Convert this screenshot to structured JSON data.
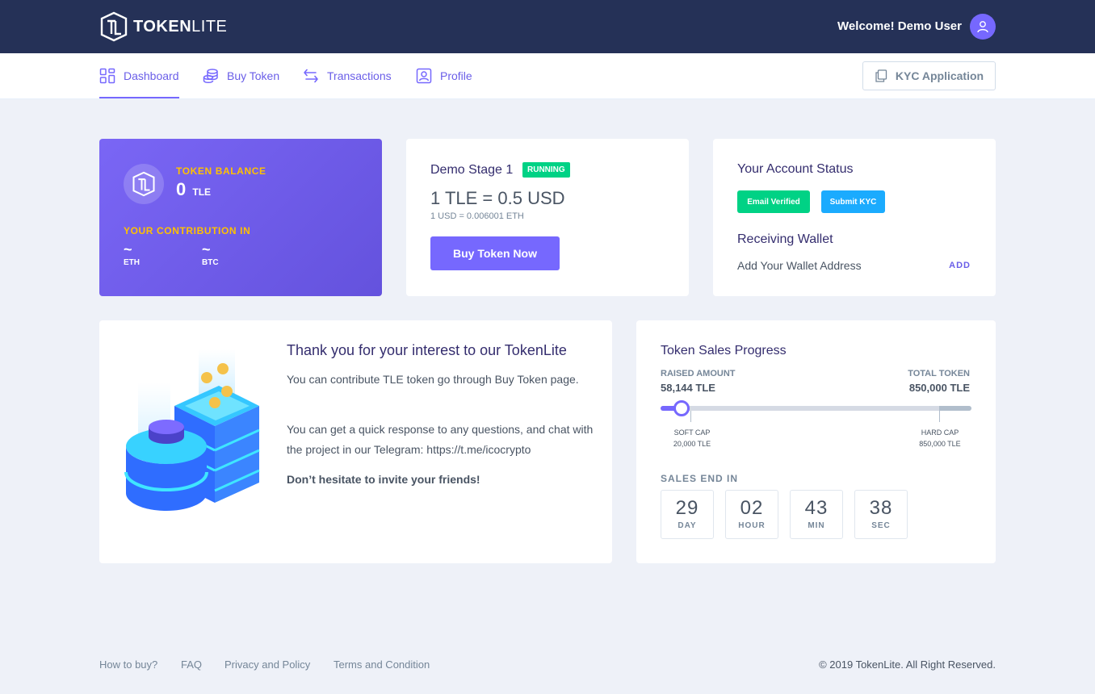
{
  "brand": {
    "logo_bold": "TOKEN",
    "logo_light": "LITE"
  },
  "header": {
    "welcome": "Welcome! Demo User"
  },
  "nav": {
    "items": [
      {
        "label": "Dashboard",
        "icon": "grid-icon"
      },
      {
        "label": "Buy Token",
        "icon": "coins-icon"
      },
      {
        "label": "Transactions",
        "icon": "exchange-arrows-icon"
      },
      {
        "label": "Profile",
        "icon": "user-card-icon"
      }
    ],
    "kyc_button": "KYC Application"
  },
  "balance": {
    "label": "TOKEN BALANCE",
    "value": "0",
    "unit": "TLE",
    "contribution_label": "YOUR CONTRIBUTION IN",
    "contributions": [
      {
        "value": "~",
        "currency": "ETH"
      },
      {
        "value": "~",
        "currency": "BTC"
      }
    ]
  },
  "stage": {
    "title": "Demo Stage 1",
    "status": "RUNNING",
    "price": "1 TLE = 0.5 USD",
    "sub_price": "1 USD = 0.006001 ETH",
    "button": "Buy Token Now"
  },
  "account": {
    "title": "Your Account Status",
    "email_badge": "Email Verified",
    "kyc_badge": "Submit KYC",
    "wallet_title": "Receiving Wallet",
    "wallet_text": "Add Your Wallet Address",
    "wallet_add": "ADD"
  },
  "info": {
    "title": "Thank you for your interest to our TokenLite",
    "p1": "You can contribute TLE token go through Buy Token page.",
    "p2": "You can get a quick response to any questions, and chat with the project in our Telegram: https://t.me/icocrypto",
    "p3": "Don’t hesitate to invite your friends!"
  },
  "progress": {
    "title": "Token Sales Progress",
    "raised_label": "RAISED AMOUNT",
    "raised_value": "58,144 TLE",
    "total_label": "TOTAL TOKEN",
    "total_value": "850,000 TLE",
    "raised_fraction": 0.0684,
    "soft_cap_label": "SOFT CAP",
    "soft_cap_value": "20,000 TLE",
    "hard_cap_label": "HARD CAP",
    "hard_cap_value": "850,000 TLE",
    "sales_end_label": "SALES END IN",
    "countdown": [
      {
        "num": "29",
        "unit": "DAY"
      },
      {
        "num": "02",
        "unit": "HOUR"
      },
      {
        "num": "43",
        "unit": "MIN"
      },
      {
        "num": "38",
        "unit": "SEC"
      }
    ]
  },
  "footer": {
    "links": [
      "How to buy?",
      "FAQ",
      "Privacy and Policy",
      "Terms and Condition"
    ],
    "copyright": "© 2019 TokenLite. All Right Reserved."
  },
  "colors": {
    "accent": "#7668fe",
    "header_bg": "#253157",
    "success": "#00d285",
    "info": "#1babfe",
    "warning": "#ffc100"
  }
}
